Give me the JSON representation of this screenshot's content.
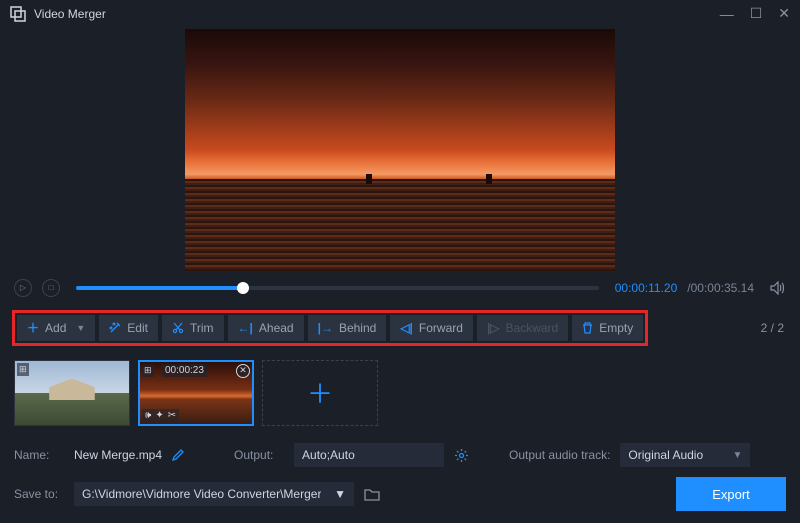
{
  "title": "Video Merger",
  "playback": {
    "current": "00:00:11.20",
    "total": "00:00:35.14"
  },
  "toolbar": {
    "add": "Add",
    "edit": "Edit",
    "trim": "Trim",
    "ahead": "Ahead",
    "behind": "Behind",
    "forward": "Forward",
    "backward": "Backward",
    "empty": "Empty"
  },
  "counter": "2 / 2",
  "clips": [
    {
      "duration": "",
      "selected": false
    },
    {
      "duration": "00:00:23",
      "selected": true
    }
  ],
  "name": {
    "label": "Name:",
    "value": "New Merge.mp4"
  },
  "output": {
    "label": "Output:",
    "value": "Auto;Auto"
  },
  "audio_track": {
    "label": "Output audio track:",
    "value": "Original Audio"
  },
  "save_to": {
    "label": "Save to:",
    "value": "G:\\Vidmore\\Vidmore Video Converter\\Merger"
  },
  "export_label": "Export"
}
